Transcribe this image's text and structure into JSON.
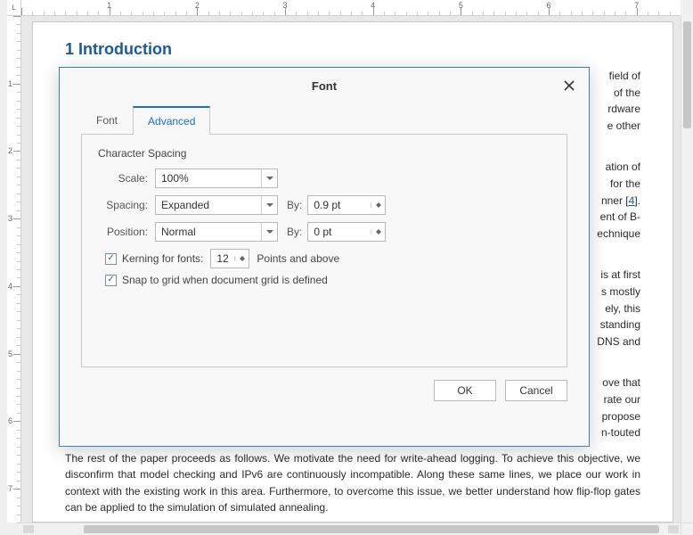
{
  "ruler": {
    "corner_label": "L",
    "h_majors": [
      1,
      2,
      3,
      4,
      5,
      6,
      7
    ],
    "v_majors": [
      1,
      2,
      3,
      4,
      5,
      6,
      7
    ]
  },
  "doc": {
    "heading": "1 Introduction",
    "para1_frag_right": [
      "field of",
      "of the",
      "rdware",
      "e other"
    ],
    "para2_frag_right": [
      "ation of",
      "for the",
      "nner [",
      "4",
      "].",
      "ent of B-",
      "echnique"
    ],
    "para3_frag_right": [
      "is at first",
      "s mostly",
      "ely, this",
      "standing",
      "DNS and"
    ],
    "para4_frag_right": [
      "ove that",
      "rate our",
      "propose",
      "n-touted"
    ],
    "para5": "The rest of the paper proceeds as follows. We motivate the need for write-ahead logging. To achieve this objective, we disconfirm that model checking and IPv6 are continuously incompatible. Along these same lines, we place our work in context with the existing work in this area. Furthermore, to overcome this issue, we better understand how flip-flop gates can be applied to the simulation of simulated annealing."
  },
  "dialog": {
    "title": "Font",
    "tabs": {
      "font": "Font",
      "advanced": "Advanced"
    },
    "section_title": "Character Spacing",
    "scale": {
      "label": "Scale:",
      "value": "100%"
    },
    "spacing": {
      "label": "Spacing:",
      "value": "Expanded",
      "by_label": "By:",
      "by_value": "0.9 pt"
    },
    "position": {
      "label": "Position:",
      "value": "Normal",
      "by_label": "By:",
      "by_value": "0 pt"
    },
    "kerning": {
      "label_before": "Kerning for fonts:",
      "value": "12",
      "label_after": "Points and above"
    },
    "snap": {
      "label": "Snap to grid when document grid is defined"
    },
    "ok": "OK",
    "cancel": "Cancel"
  }
}
